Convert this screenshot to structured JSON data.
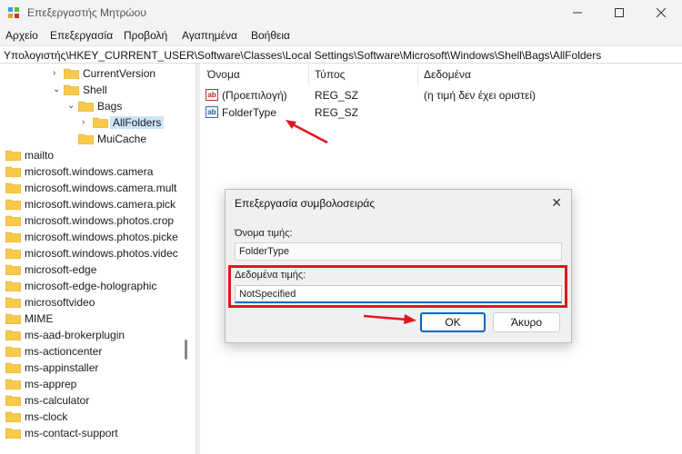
{
  "window": {
    "title": "Επεξεργαστής Μητρώου"
  },
  "menu": [
    "Αρχείο",
    "Επεξεργασία",
    "Προβολή",
    "Αγαπημένα",
    "Βοήθεια"
  ],
  "address": "Υπολογιστής\\HKEY_CURRENT_USER\\Software\\Classes\\Local Settings\\Software\\Microsoft\\Windows\\Shell\\Bags\\AllFolders",
  "tree": {
    "nested": [
      {
        "label": "CurrentVersion",
        "chevron": "right"
      },
      {
        "label": "Shell",
        "chevron": "down"
      },
      {
        "label": "Bags",
        "chevron": "down"
      },
      {
        "label": "AllFolders",
        "chevron": "right",
        "selected": true
      },
      {
        "label": "MuiCache",
        "chevron": "none"
      }
    ],
    "keys": [
      "mailto",
      "microsoft.windows.camera",
      "microsoft.windows.camera.mult",
      "microsoft.windows.camera.pick",
      "microsoft.windows.photos.crop",
      "microsoft.windows.photos.picke",
      "microsoft.windows.photos.videc",
      "microsoft-edge",
      "microsoft-edge-holographic",
      "microsoftvideo",
      "MIME",
      "ms-aad-brokerplugin",
      "ms-actioncenter",
      "ms-appinstaller",
      "ms-apprep",
      "ms-calculator",
      "ms-clock",
      "ms-contact-support"
    ]
  },
  "values": {
    "headers": {
      "name": "Όνομα",
      "type": "Τύπος",
      "data": "Δεδομένα"
    },
    "rows": [
      {
        "name": "(Προεπιλογή)",
        "type": "REG_SZ",
        "data": "(η τιμή δεν έχει οριστεί)",
        "icon": "string-value-icon"
      },
      {
        "name": "FolderType",
        "type": "REG_SZ",
        "data": "",
        "icon": "string-value-icon"
      }
    ]
  },
  "dialog": {
    "title": "Επεξεργασία συμβολοσειράς",
    "value_name_label": "Όνομα τιμής:",
    "value_name": "FolderType",
    "value_data_label": "Δεδομένα τιμής:",
    "value_data": "NotSpecified",
    "ok": "OK",
    "cancel": "Άκυρο"
  },
  "colors": {
    "annotation": "#e0161e",
    "accent": "#0067c0",
    "folder": "#f8c94a"
  }
}
